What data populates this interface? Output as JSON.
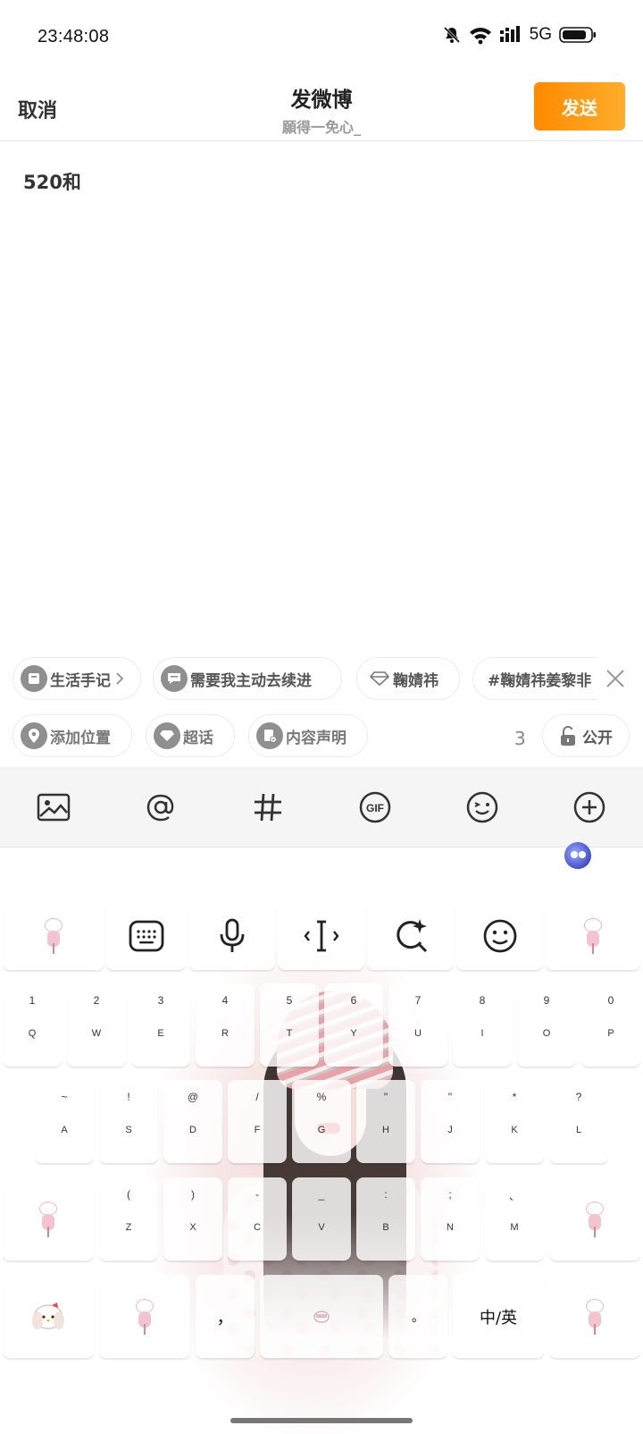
{
  "status_bar": {
    "time": "23:48:08",
    "network": "5G"
  },
  "header": {
    "cancel": "取消",
    "title": "发微博",
    "subtitle": "願得一免心_",
    "send": "发送"
  },
  "compose": {
    "text": "520和"
  },
  "topic_chips": [
    {
      "label": "生活手记",
      "icon": "notebook-icon"
    },
    {
      "label": "需要我主动去续进",
      "icon": "chat-icon"
    },
    {
      "label": "鞠婧祎",
      "icon": "diamond-icon"
    },
    {
      "label": "#鞠婧祎姜黎非"
    }
  ],
  "option_chips": [
    {
      "label": "添加位置",
      "icon": "location-icon"
    },
    {
      "label": "超话",
      "icon": "diamond-icon"
    },
    {
      "label": "内容声明",
      "icon": "declaration-icon"
    }
  ],
  "count": "3",
  "visibility": "公开",
  "toolbar": [
    "image-icon",
    "at-icon",
    "hashtag-icon",
    "gif-icon",
    "emoji-icon",
    "plus-icon"
  ],
  "keyboard": {
    "row1": [
      {
        "sub": "1",
        "main": "Q"
      },
      {
        "sub": "2",
        "main": "W"
      },
      {
        "sub": "3",
        "main": "E"
      },
      {
        "sub": "4",
        "main": "R"
      },
      {
        "sub": "5",
        "main": "T"
      },
      {
        "sub": "6",
        "main": "Y"
      },
      {
        "sub": "7",
        "main": "U"
      },
      {
        "sub": "8",
        "main": "I"
      },
      {
        "sub": "9",
        "main": "O"
      },
      {
        "sub": "0",
        "main": "P"
      }
    ],
    "row2": [
      {
        "sub": "~",
        "main": "A"
      },
      {
        "sub": "!",
        "main": "S"
      },
      {
        "sub": "@",
        "main": "D"
      },
      {
        "sub": "/",
        "main": "F"
      },
      {
        "sub": "%",
        "main": "G"
      },
      {
        "sub": "\"",
        "main": "H"
      },
      {
        "sub": "\"",
        "main": "J"
      },
      {
        "sub": "*",
        "main": "K"
      },
      {
        "sub": "?",
        "main": "L"
      }
    ],
    "row3": [
      {
        "sub": "(",
        "main": "Z"
      },
      {
        "sub": ")",
        "main": "X"
      },
      {
        "sub": "-",
        "main": "C"
      },
      {
        "sub": "_",
        "main": "V"
      },
      {
        "sub": ":",
        "main": "B"
      },
      {
        "sub": ";",
        "main": "N"
      },
      {
        "sub": "、",
        "main": "M"
      }
    ],
    "comma": "，",
    "period": "。",
    "lang_toggle": "中/英"
  }
}
